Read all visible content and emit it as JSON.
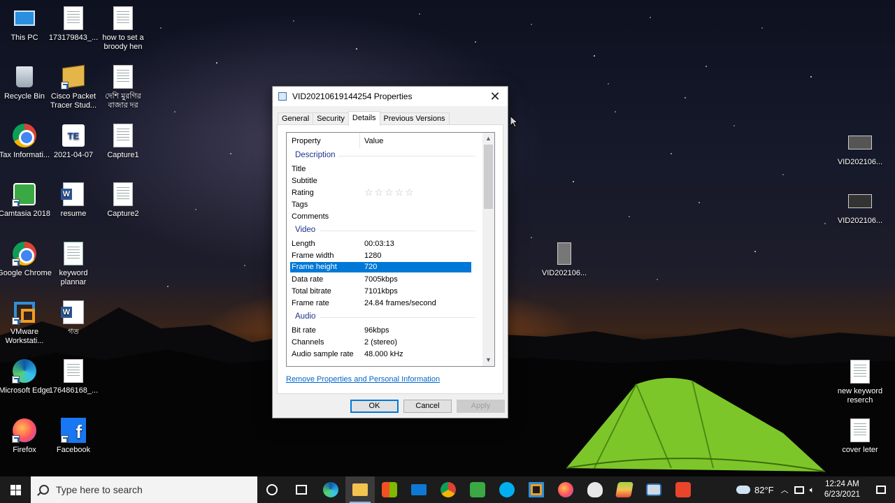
{
  "desktop": {
    "icons_left": [
      {
        "label": "This PC"
      },
      {
        "label": "173179843_..."
      },
      {
        "label": "how to set a broody hen"
      },
      {
        "label": "Recycle Bin"
      },
      {
        "label": "Cisco Packet Tracer Stud..."
      },
      {
        "label": "দেশি মুরগির বাজার দর"
      },
      {
        "label": "Tax Informati..."
      },
      {
        "label": "2021-04-07"
      },
      {
        "label": "Capture1"
      },
      {
        "label": "Camtasia 2018"
      },
      {
        "label": "resume"
      },
      {
        "label": "Capture2"
      },
      {
        "label": "Google Chrome"
      },
      {
        "label": "keyword plannar"
      },
      {
        "label": "VMware Workstati..."
      },
      {
        "label": "গত"
      },
      {
        "label": "Microsoft Edge"
      },
      {
        "label": "176486168_..."
      },
      {
        "label": "Firefox"
      },
      {
        "label": "Facebook"
      }
    ],
    "icons_right": [
      {
        "label": "VID202106..."
      },
      {
        "label": "VID202106..."
      },
      {
        "label": "VID202106..."
      },
      {
        "label": "new keyword reserch"
      },
      {
        "label": "cover leter"
      }
    ]
  },
  "dialog": {
    "title": "VID20210619144254 Properties",
    "close_glyph": "✕",
    "tabs": [
      "General",
      "Security",
      "Details",
      "Previous Versions"
    ],
    "active_tab": "Details",
    "columns": {
      "property": "Property",
      "value": "Value"
    },
    "groups": {
      "description": "Description",
      "video": "Video",
      "audio": "Audio"
    },
    "description_rows": [
      {
        "key": "Title",
        "value": ""
      },
      {
        "key": "Subtitle",
        "value": ""
      },
      {
        "key": "Rating",
        "value": "☆☆☆☆☆"
      },
      {
        "key": "Tags",
        "value": ""
      },
      {
        "key": "Comments",
        "value": ""
      }
    ],
    "video_rows": [
      {
        "key": "Length",
        "value": "00:03:13"
      },
      {
        "key": "Frame width",
        "value": "1280"
      },
      {
        "key": "Frame height",
        "value": "720"
      },
      {
        "key": "Data rate",
        "value": "7005kbps"
      },
      {
        "key": "Total bitrate",
        "value": "7101kbps"
      },
      {
        "key": "Frame rate",
        "value": "24.84 frames/second"
      }
    ],
    "audio_rows": [
      {
        "key": "Bit rate",
        "value": "96kbps"
      },
      {
        "key": "Channels",
        "value": "2 (stereo)"
      },
      {
        "key": "Audio sample rate",
        "value": "48.000 kHz"
      }
    ],
    "selected_row": "Frame height",
    "remove_link": "Remove Properties and Personal Information",
    "buttons": {
      "ok": "OK",
      "cancel": "Cancel",
      "apply": "Apply"
    }
  },
  "taskbar": {
    "search_placeholder": "Type here to search",
    "weather": "82°F",
    "time": "12:24 AM",
    "date": "6/23/2021",
    "pinned": [
      "cortana",
      "task-view",
      "edge",
      "file-explorer",
      "store",
      "mail",
      "chrome",
      "camtasia",
      "skype",
      "vmware",
      "firefox",
      "paint",
      "bluestacks",
      "remote-desktop",
      "camtasia-recorder"
    ],
    "active_app": "file-explorer"
  },
  "colors": {
    "selection": "#0078d7",
    "group_header": "#1e3287",
    "link": "#0066cc",
    "taskbar": "#1c1c1c"
  }
}
